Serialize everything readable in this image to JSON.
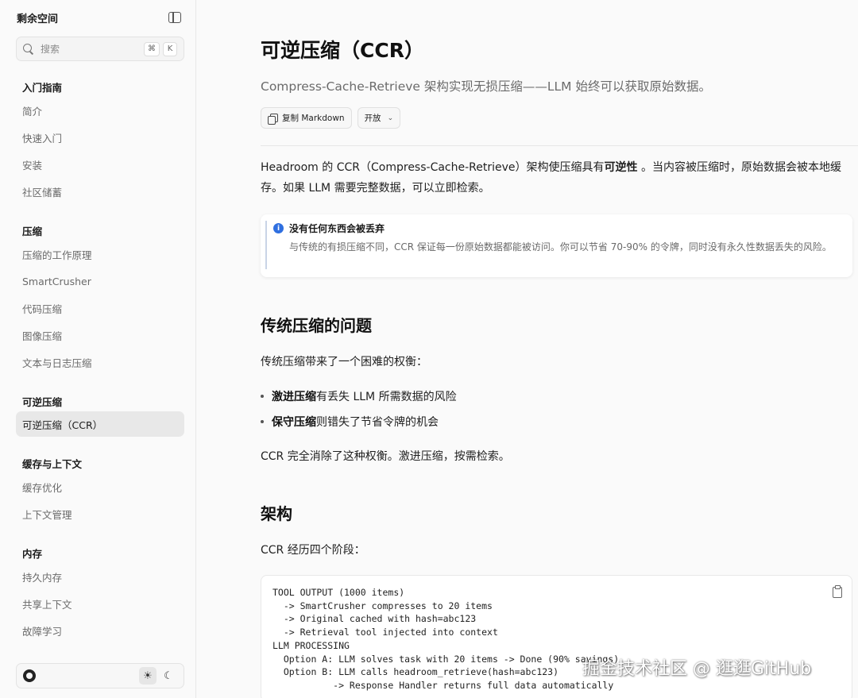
{
  "sidebar": {
    "brand": "剩余空间",
    "search": {
      "placeholder": "搜索",
      "shortcut_mod": "⌘",
      "shortcut_key": "K"
    },
    "groups": [
      {
        "title": "入门指南",
        "items": [
          "简介",
          "快速入门",
          "安装",
          "社区储蓄"
        ]
      },
      {
        "title": "压缩",
        "items": [
          "压缩的工作原理",
          "SmartCrusher",
          "代码压缩",
          "图像压缩",
          "文本与日志压缩"
        ]
      },
      {
        "title": "可逆压缩",
        "items": [
          "可逆压缩（CCR）"
        ]
      },
      {
        "title": "缓存与上下文",
        "items": [
          "缓存优化",
          "上下文管理"
        ]
      },
      {
        "title": "内存",
        "items": [
          "持久内存",
          "共享上下文",
          "故障学习"
        ]
      }
    ],
    "active_item": "可逆压缩（CCR）",
    "theme": {
      "light": "☀",
      "dark": "☾"
    }
  },
  "main": {
    "title": "可逆压缩（CCR）",
    "subtitle": "Compress-Cache-Retrieve 架构实现无损压缩——LLM 始终可以获取原始数据。",
    "copy_label": "复制 Markdown",
    "open_label": "开放",
    "intro_pre": "Headroom 的 CCR（Compress-Cache-Retrieve）架构使压缩具有",
    "intro_bold": "可逆性",
    "intro_post": " 。当内容被压缩时，原始数据会被本地缓",
    "intro_line2": "存。如果 LLM 需要完整数据，可以立即检索。",
    "callout_title": "没有任何东西会被丢弃",
    "callout_body": "与传统的有损压缩不同，CCR 保证每一份原始数据都能被访问。你可以节省 70-90% 的令牌，同时没有永久性数据丢失的风险。",
    "section1_title": "传统压缩的问题",
    "section1_intro": "传统压缩带来了一个困难的权衡：",
    "bullet1_bold": "激进压缩",
    "bullet1_text": "有丢失 LLM 所需数据的风险",
    "bullet2_bold": "保守压缩",
    "bullet2_text": "则错失了节省令牌的机会",
    "section1_outro": "CCR 完全消除了这种权衡。激进压缩，按需检索。",
    "section2_title": "架构",
    "section2_intro": "CCR 经历四个阶段：",
    "code_lines": [
      "TOOL OUTPUT (1000 items)",
      "  -> SmartCrusher compresses to 20 items",
      "  -> Original cached with hash=abc123",
      "  -> Retrieval tool injected into context",
      "LLM PROCESSING",
      "  Option A: LLM solves task with 20 items -> Done (90% savings)",
      "  Option B: LLM calls headroom_retrieve(hash=abc123)",
      "           -> Response Handler returns full data automatically"
    ]
  },
  "watermark": "掘金技术社区 @ 逛逛GitHub"
}
